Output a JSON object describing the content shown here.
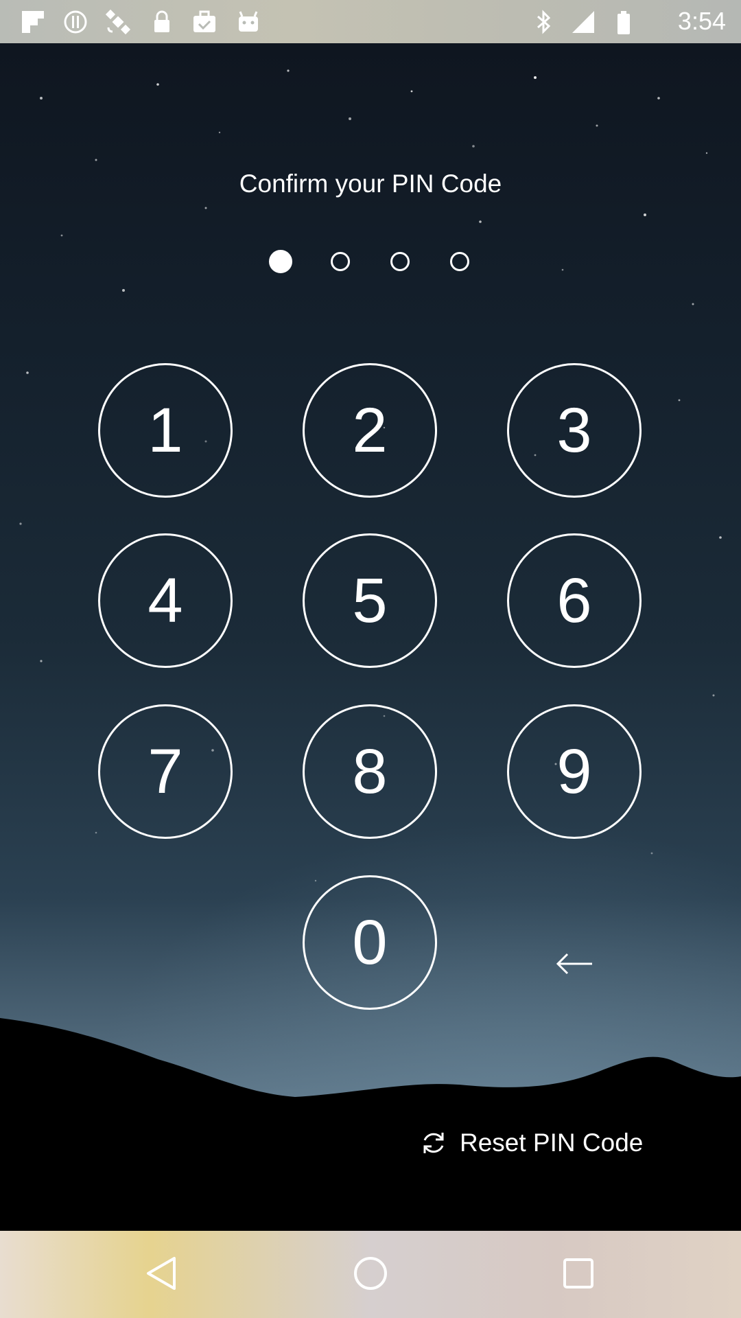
{
  "status_bar": {
    "time": "3:54",
    "left_icons": [
      "flipboard-icon",
      "info-circle-icon",
      "satellite-icon",
      "lock-icon",
      "briefcase-check-icon",
      "android-icon"
    ],
    "right_icons": [
      "bluetooth-icon",
      "signal-icon",
      "battery-icon"
    ]
  },
  "pin": {
    "title": "Confirm your PIN Code",
    "length": 4,
    "entered": 1,
    "keys": [
      "1",
      "2",
      "3",
      "4",
      "5",
      "6",
      "7",
      "8",
      "9",
      "0"
    ],
    "backspace_icon": "arrow-left-icon",
    "reset_label": "Reset PIN Code",
    "reset_icon": "refresh-icon"
  },
  "nav_bar": {
    "buttons": [
      "back-icon",
      "home-icon",
      "recents-icon"
    ]
  },
  "colors": {
    "text": "#ffffff",
    "sky_top": "#0f1620",
    "sky_bottom": "#8aa0b0"
  }
}
